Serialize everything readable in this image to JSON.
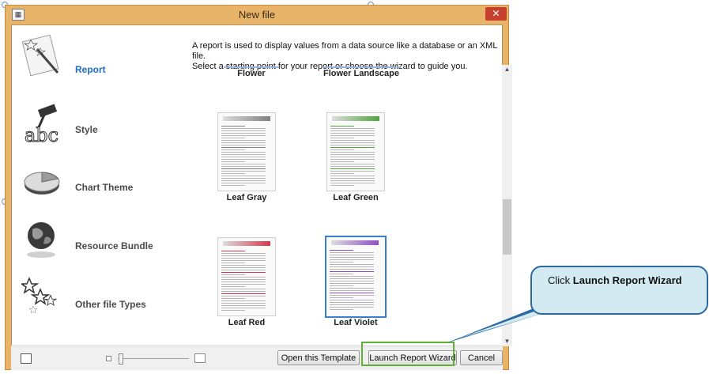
{
  "window": {
    "title": "New file",
    "close_glyph": "✕",
    "app_icon": "report-app-icon"
  },
  "sidebar": {
    "items": [
      {
        "label": "Report",
        "icon": "report-icon",
        "active": true
      },
      {
        "label": "Style",
        "icon": "style-icon",
        "active": false
      },
      {
        "label": "Chart Theme",
        "icon": "chart-theme-icon",
        "active": false
      },
      {
        "label": "Resource Bundle",
        "icon": "resource-bundle-icon",
        "active": false
      },
      {
        "label": "Other file Types",
        "icon": "other-file-types-icon",
        "active": false
      }
    ]
  },
  "description": {
    "line1": "A report is used to display values from a data source like a database or an XML file.",
    "line2": "Select a starting point for your report or choose the wizard to guide you."
  },
  "templates": [
    {
      "name": "Flower",
      "accent": "#9ab3d8",
      "selected": false
    },
    {
      "name": "Flower Landscape",
      "accent": "#9ab3d8",
      "selected": false
    },
    {
      "name": "Leaf Gray",
      "accent": "#7f7f7f",
      "selected": false
    },
    {
      "name": "Leaf Green",
      "accent": "#4fa43a",
      "selected": false
    },
    {
      "name": "Leaf Red",
      "accent": "#d9374b",
      "selected": false
    },
    {
      "name": "Leaf Violet",
      "accent": "#8f4fc6",
      "selected": true
    }
  ],
  "buttons": {
    "open_template": "Open this Template",
    "launch_wizard": "Launch Report Wizard",
    "cancel": "Cancel"
  },
  "callout": {
    "prefix": "Click ",
    "emphasis": "Launch Report Wizard"
  },
  "colors": {
    "frame": "#e8b46a",
    "active_label": "#1e6fc2",
    "highlight": "#5db235",
    "callout_fill": "#d3eaf2",
    "callout_border": "#2b6aa0"
  }
}
